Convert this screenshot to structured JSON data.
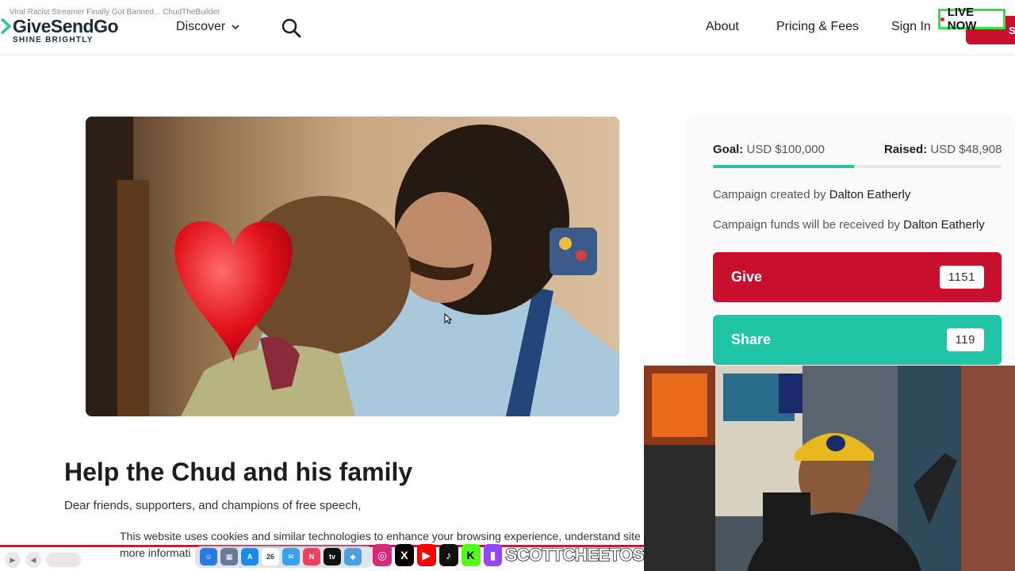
{
  "video_title": "Viral Racist Streamer Finally Got Banned... ChudTheBuilder",
  "brand": {
    "name": "GiveSendGo",
    "tagline": "SHINE BRIGHTLY",
    "accent_color": "#c8102e"
  },
  "header": {
    "discover_label": "Discover",
    "nav": {
      "about": "About",
      "pricing": "Pricing & Fees",
      "sign_in": "Sign In"
    },
    "start_label": "Start",
    "live_badge": "LIVE NOW",
    "search_icon": "search-icon"
  },
  "campaign": {
    "title": "Help the Chud and his family",
    "greeting": "Dear friends, supporters, and champions of free speech,",
    "goal_label": "Goal:",
    "goal_value": "USD $100,000",
    "raised_label": "Raised:",
    "raised_value": "USD $48,908",
    "progress_fraction": 0.489,
    "created_by_prefix": "Campaign created by",
    "created_by_name": "Dalton Eatherly",
    "funds_prefix": "Campaign funds will be received by",
    "funds_name": "Dalton Eatherly",
    "give_label": "Give",
    "give_count": "1151",
    "share_label": "Share",
    "share_count": "119",
    "give_color": "#c8102e",
    "share_color": "#20c5a8"
  },
  "cookie_banner": {
    "line1": "This website uses cookies and similar technologies to enhance your browsing experience, understand site usage",
    "line2": "more informati"
  },
  "stream_overlay": {
    "handle": "SCOTTCHEETOS",
    "dock_date": "26",
    "social_icons": [
      "instagram-icon",
      "x-icon",
      "youtube-icon",
      "tiktok-icon",
      "kick-icon",
      "twitch-icon"
    ]
  }
}
